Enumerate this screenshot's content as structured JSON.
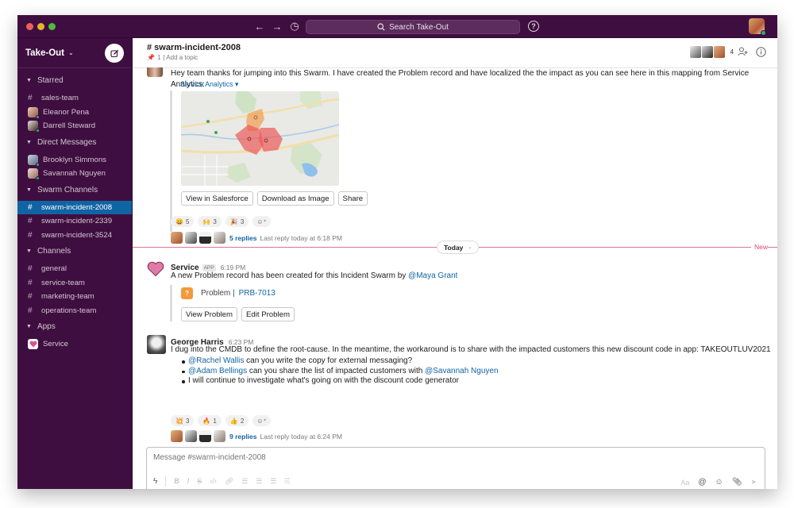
{
  "titlebar": {
    "search_placeholder": "Search Take-Out",
    "back_icon": "←",
    "forward_icon": "→",
    "history_icon": "◷",
    "help_icon": "?"
  },
  "sidebar": {
    "workspace": "Take-Out",
    "sections": [
      {
        "label": "Starred",
        "items": [
          {
            "type": "channel",
            "label": "sales-team"
          },
          {
            "type": "dm",
            "label": "Eleanor Pena"
          },
          {
            "type": "dm",
            "label": "Darrell Steward"
          }
        ]
      },
      {
        "label": "Direct Messages",
        "items": [
          {
            "type": "dm",
            "label": "Brooklyn Simmons"
          },
          {
            "type": "dm",
            "label": "Savannah Nguyen"
          }
        ]
      },
      {
        "label": "Swarm Channels",
        "items": [
          {
            "type": "channel",
            "label": "swarm-incident-2008",
            "active": true
          },
          {
            "type": "channel",
            "label": "swarm-incident-2339"
          },
          {
            "type": "channel",
            "label": "swarm-incident-3524"
          }
        ]
      },
      {
        "label": "Channels",
        "items": [
          {
            "type": "channel",
            "label": "general"
          },
          {
            "type": "channel",
            "label": "service-team"
          },
          {
            "type": "channel",
            "label": "marketing-team"
          },
          {
            "type": "channel",
            "label": "operations-team"
          }
        ]
      },
      {
        "label": "Apps",
        "items": [
          {
            "type": "app",
            "label": "Service"
          }
        ]
      }
    ]
  },
  "channel": {
    "title": "# swarm-incident-2008",
    "pin_count": "1",
    "topic": "| Add a topic",
    "member_count": "4"
  },
  "messages": {
    "first": {
      "text": "Hey team thanks for jumping into this Swarm. I have created the Problem record and have localized the the impact as you can see here in this mapping from Service Analytics:",
      "attachment_title": "Service Analytics ▾",
      "buttons": [
        "View in Salesforce",
        "Download as Image",
        "Share"
      ],
      "reactions": [
        {
          "emoji": "😄",
          "count": "5"
        },
        {
          "emoji": "🙌",
          "count": "3"
        },
        {
          "emoji": "🎉",
          "count": "3"
        }
      ],
      "replies": "5 replies",
      "last_reply": "Last reply today at 6:18 PM"
    },
    "divider": {
      "label": "Today",
      "new_label": "New"
    },
    "service": {
      "author": "Service",
      "badge": "APP",
      "time": "6:19 PM",
      "text": "A new Problem record has been created for this Incident Swarm by ",
      "mention": "@Maya Grant",
      "record_type": "Problem |",
      "record_id": "PRB-7013",
      "buttons": [
        "View Problem",
        "Edit Problem"
      ]
    },
    "george": {
      "author": "George Harris",
      "time": "6:23 PM",
      "text": "I dug into the CMDB to define the root-cause. In the meantime, the workaround is to share with the impacted customers this new discount code in app: TAKEOUTLUV2021",
      "bullets": [
        {
          "mention": "@Rachel Wallis",
          "text": " can you write the copy for external messaging?"
        },
        {
          "mention": "@Adam Bellings",
          "text": " can you share the list of impacted customers with ",
          "mention2": "@Savannah Nguyen"
        },
        {
          "text": "I will continue to investigate what's going on with the discount code generator"
        }
      ],
      "reactions": [
        {
          "emoji": "💥",
          "count": "3"
        },
        {
          "emoji": "🔥",
          "count": "1"
        },
        {
          "emoji": "👍",
          "count": "2"
        }
      ],
      "replies": "9 replies",
      "last_reply": "Last reply today at 6:24 PM"
    }
  },
  "composer": {
    "placeholder": "Message #swarm-incident-2008",
    "format_text_label": "Aa"
  },
  "colors": {
    "sidebar_bg": "#3f0e40",
    "active_item": "#1164a3",
    "link": "#1264a3",
    "new_divider": "#d7779a",
    "presence": "#2bac76"
  }
}
